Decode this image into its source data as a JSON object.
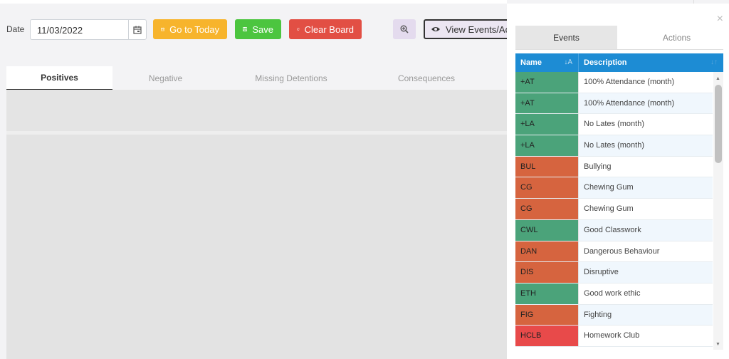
{
  "toolbar": {
    "date_label": "Date",
    "date_value": "11/03/2022",
    "go_today_label": "Go to Today",
    "save_label": "Save",
    "clear_label": "Clear Board",
    "view_label": "View Events/Acti"
  },
  "tabs": {
    "positives": "Positives",
    "negative": "Negative",
    "missing": "Missing Detentions",
    "consequences": "Consequences"
  },
  "panel": {
    "close": "×",
    "tab_events": "Events",
    "tab_actions": "Actions",
    "col_name": "Name",
    "col_desc": "Description",
    "rows": [
      {
        "name": "+AT",
        "desc": "100% Attendance (month)",
        "color": "#4ba37a"
      },
      {
        "name": "+AT",
        "desc": "100% Attendance (month)",
        "color": "#4ba37a"
      },
      {
        "name": "+LA",
        "desc": "No Lates (month)",
        "color": "#4ba37a"
      },
      {
        "name": "+LA",
        "desc": "No Lates (month)",
        "color": "#4ba37a"
      },
      {
        "name": "BUL",
        "desc": "Bullying",
        "color": "#d6643f"
      },
      {
        "name": "CG",
        "desc": "Chewing Gum",
        "color": "#d6643f"
      },
      {
        "name": "CG",
        "desc": "Chewing Gum",
        "color": "#d6643f"
      },
      {
        "name": "CWL",
        "desc": "Good Classwork",
        "color": "#4ba37a"
      },
      {
        "name": "DAN",
        "desc": "Dangerous Behaviour",
        "color": "#d6643f"
      },
      {
        "name": "DIS",
        "desc": "Disruptive",
        "color": "#d6643f"
      },
      {
        "name": "ETH",
        "desc": "Good work ethic",
        "color": "#4ba37a"
      },
      {
        "name": "FIG",
        "desc": "Fighting",
        "color": "#d6643f"
      },
      {
        "name": "HCLB",
        "desc": "Homework Club",
        "color": "#e84a4a"
      }
    ]
  }
}
